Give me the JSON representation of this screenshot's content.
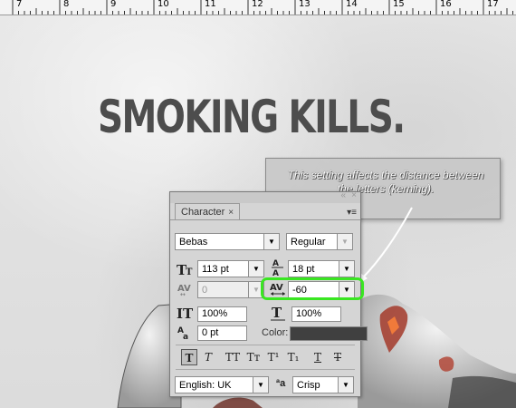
{
  "ruler": {
    "numbers": [
      "7",
      "8",
      "9",
      "10",
      "11",
      "12",
      "13",
      "14",
      "15",
      "16",
      "17"
    ]
  },
  "canvas": {
    "headline": "SMOKING KILLS."
  },
  "callout": {
    "text": "This setting affects the distance between the letters (kerning)."
  },
  "panel": {
    "tab_label": "Character",
    "tab_close": "×",
    "collapse_btn": "«",
    "close_btn": "×",
    "menu_icon": "▾≡",
    "font_family": "Bebas",
    "font_style": "Regular",
    "font_size": "113 pt",
    "leading": "18 pt",
    "kerning": "0",
    "tracking": "-60",
    "vertical_scale": "100%",
    "horizontal_scale": "100%",
    "baseline_shift": "0 pt",
    "color_label": "Color:",
    "text_color": "#404040",
    "language": "English: UK",
    "antialias_label": "ªa",
    "antialias": "Crisp",
    "style_buttons": [
      "T",
      "T",
      "TT",
      "Tт",
      "T¹",
      "T₁",
      "T",
      "T"
    ]
  },
  "highlight_color": "#39e621"
}
